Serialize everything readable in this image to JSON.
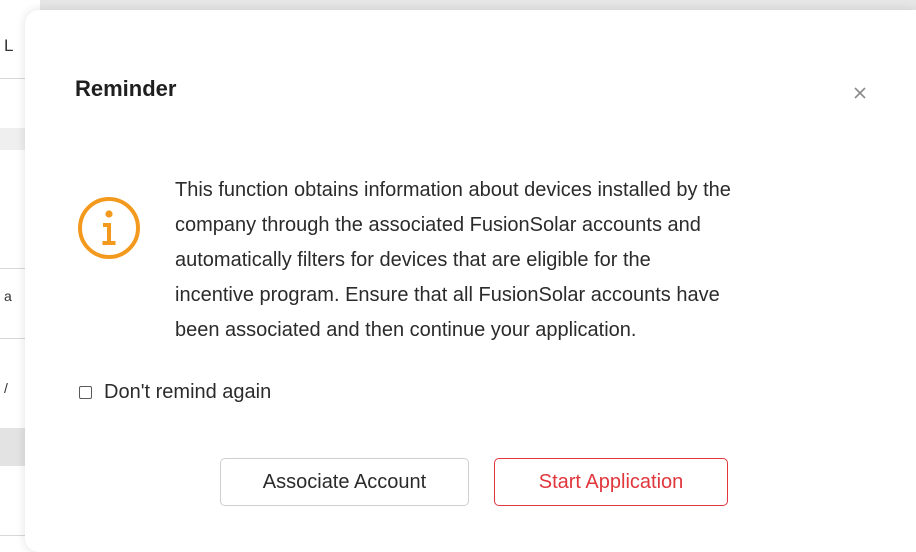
{
  "background_fragments": {
    "top": "L",
    "mid": "a",
    "lower": "/"
  },
  "dialog": {
    "title": "Reminder",
    "close_icon": "close-icon",
    "info_icon": "info-circle-icon",
    "accent_color": "#f39a1e",
    "message": "This function obtains information about devices installed by the company through the associated FusionSolar accounts and automatically filters for devices that are eligible for the incentive program. Ensure that all FusionSolar accounts have been associated and then continue your application.",
    "message_lines": [
      "This function obtains information about devices installed by the",
      "company through the associated FusionSolar accounts and",
      "automatically filters for devices that are eligible for the",
      "incentive program. Ensure that all FusionSolar accounts have",
      "been associated and then continue your application."
    ],
    "remind_checkbox": {
      "label": "Don't remind again",
      "checked": false
    },
    "buttons": {
      "associate_label": "Associate Account",
      "start_label": "Start Application",
      "start_color": "#e0363c"
    }
  }
}
